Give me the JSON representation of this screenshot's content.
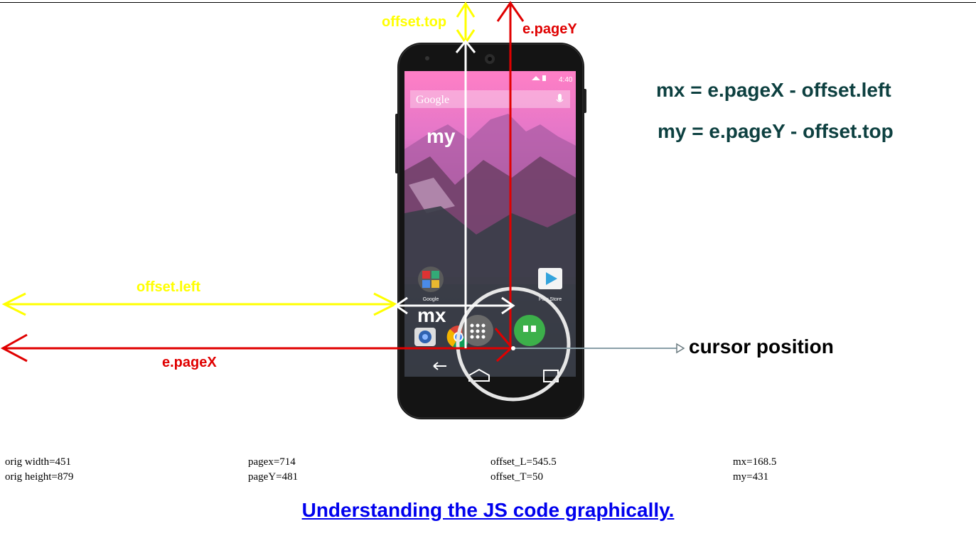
{
  "labels": {
    "offset_top": "offset.top",
    "page_y": "e.pageY",
    "offset_left": "offset.left",
    "page_x": "e.pageX",
    "my": "my",
    "mx": "mx",
    "cursor_position": "cursor position"
  },
  "formulas": {
    "mx": "mx = e.pageX - offset.left",
    "my": "my = e.pageY - offset.top"
  },
  "phone": {
    "status_time": "4:40",
    "search_text": "Google",
    "app_google": "Google",
    "app_store": "Play Store"
  },
  "stats": {
    "orig_width": "orig width=451",
    "orig_height": "orig height=879",
    "pagex": "pagex=714",
    "pagey": "pageY=481",
    "offset_l": "offset_L=545.5",
    "offset_t": "offset_T=50",
    "mx": "mx=168.5",
    "my": "my=431"
  },
  "link_text": "Understanding the JS code graphically.",
  "colors": {
    "offset_arrows": "#ffff00",
    "page_arrows": "#e00000",
    "m_arrows": "#ffffff",
    "formula_text": "#0d4040",
    "link": "#0000ee"
  }
}
